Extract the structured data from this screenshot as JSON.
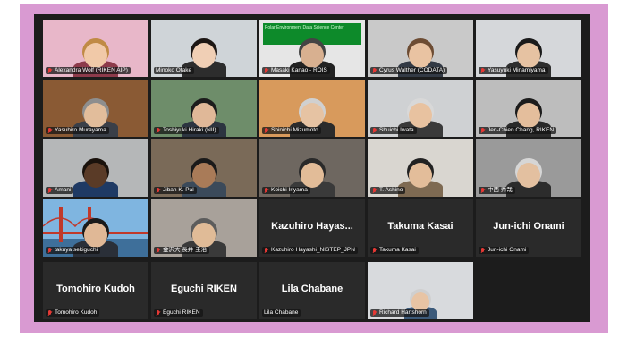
{
  "participants": [
    {
      "name": "Alexandra Wolf (RIKEN AIP)",
      "muted": true,
      "video": true,
      "bg": "#e8b7c9",
      "skin": "#f1c9a8",
      "hair": "#c08a45",
      "shirt": "#8d3b4b"
    },
    {
      "name": "Minoko Otake",
      "muted": false,
      "video": true,
      "bg": "#cfd4d8",
      "skin": "#f0cfb5",
      "hair": "#1d1714",
      "shirt": "#2d2d2d",
      "active": true
    },
    {
      "name": "Masaki Kanao - ROIS",
      "muted": true,
      "video": true,
      "bg": "#e6e6e6",
      "skin": "#d8b090",
      "hair": "#444444",
      "shirt": "#222222",
      "overlay": "Polar Environment Data Science Center"
    },
    {
      "name": "Cyrus Walther (CODATA)",
      "muted": true,
      "video": true,
      "bg": "#c9c9c9",
      "skin": "#e9c3a2",
      "hair": "#6d4c33",
      "shirt": "#333a45"
    },
    {
      "name": "Yasuyuki Minamiyama",
      "muted": true,
      "video": true,
      "bg": "#d5d7da",
      "skin": "#e6c2a2",
      "hair": "#1b1b1b",
      "shirt": "#2e2e2e"
    },
    {
      "name": "Yasuhiro Murayama",
      "muted": true,
      "video": true,
      "bg": "#8a5a34",
      "skin": "#e2bd9b",
      "hair": "#8e8e8e",
      "shirt": "#3a3f48"
    },
    {
      "name": "Toshiyuki Hiraki (NII)",
      "muted": true,
      "video": true,
      "bg": "#6e8d6a",
      "skin": "#e0b898",
      "hair": "#1c1c1c",
      "shirt": "#2c3440"
    },
    {
      "name": "Shinichi Mizumoto",
      "muted": true,
      "video": true,
      "bg": "#d89a5c",
      "skin": "#e6c3a3",
      "hair": "#d0d0d0",
      "shirt": "#2b2b2b"
    },
    {
      "name": "Shuichi Iwata",
      "muted": true,
      "video": true,
      "bg": "#cfd1d3",
      "skin": "#e8c2a0",
      "hair": "#d8d8d8",
      "shirt": "#3a3a3a"
    },
    {
      "name": "Jen-Chien Chang, RIKEN",
      "muted": true,
      "video": true,
      "bg": "#bdbdbd",
      "skin": "#e4be9c",
      "hair": "#1c1c1c",
      "shirt": "#2a2a2a"
    },
    {
      "name": "Amani",
      "muted": true,
      "video": true,
      "bg": "#b5b7b8",
      "skin": "#5a3b27",
      "hair": "#1a120c",
      "shirt": "#1f3a64"
    },
    {
      "name": "Jiban K. Pal",
      "muted": true,
      "video": true,
      "bg": "#7a6a58",
      "skin": "#a97b58",
      "hair": "#1a1a1a",
      "shirt": "#3b4a5a"
    },
    {
      "name": "Koichi Iriyama",
      "muted": true,
      "video": true,
      "bg": "#6e6760",
      "skin": "#e2bc98",
      "hair": "#2a2a2a",
      "shirt": "#3a3a3a"
    },
    {
      "name": "T. Ashino",
      "muted": true,
      "video": true,
      "bg": "#d9d6d0",
      "skin": "#e3bd9a",
      "hair": "#222222",
      "shirt": "#7e6a52"
    },
    {
      "name": "中西 秀哉",
      "muted": true,
      "video": true,
      "bg": "#9a9a9a",
      "skin": "#e3c0a0",
      "hair": "#d6d6d6",
      "shirt": "#2c2c2c"
    },
    {
      "name": "takuya sekiguchi",
      "muted": true,
      "video": true,
      "bg": "#7fb5e0",
      "skin": "#e0b896",
      "hair": "#1a1a1a",
      "shirt": "#2a2f38",
      "bridge": true
    },
    {
      "name": "金沢大 長井 圭治",
      "muted": true,
      "video": true,
      "bg": "#a8a19a",
      "skin": "#e0bb97",
      "hair": "#5c5c5c",
      "shirt": "#3a3a3a"
    },
    {
      "name": "Kazuhiro Hayashi_NISTEP_JPN",
      "muted": true,
      "video": false,
      "display": "Kazuhiro  Hayas..."
    },
    {
      "name": "Takuma Kasai",
      "muted": true,
      "video": false,
      "display": "Takuma Kasai"
    },
    {
      "name": "Jun-ichi Onami",
      "muted": true,
      "video": false,
      "display": "Jun-ichi Onami"
    }
  ],
  "bottom_row": [
    {
      "name": "Tomohiro Kudoh",
      "muted": true,
      "video": false,
      "display": "Tomohiro Kudoh"
    },
    {
      "name": "Eguchi RIKEN",
      "muted": true,
      "video": false,
      "display": "Eguchi RIKEN"
    },
    {
      "name": "Lila Chabane",
      "muted": false,
      "video": false,
      "display": "Lila Chabane"
    },
    {
      "name": "Richard Hartshorn",
      "muted": true,
      "video": true,
      "bg": "#d8dadd",
      "skin": "#e8c4a4",
      "hair": "#cfcfcf",
      "shirt": "#3c5a7a",
      "small": true
    }
  ],
  "colors": {
    "frame_border": "#d99ad2",
    "meeting_bg": "#1c1c1c",
    "active_speaker": "#52d06c",
    "muted_icon": "#e53935"
  }
}
